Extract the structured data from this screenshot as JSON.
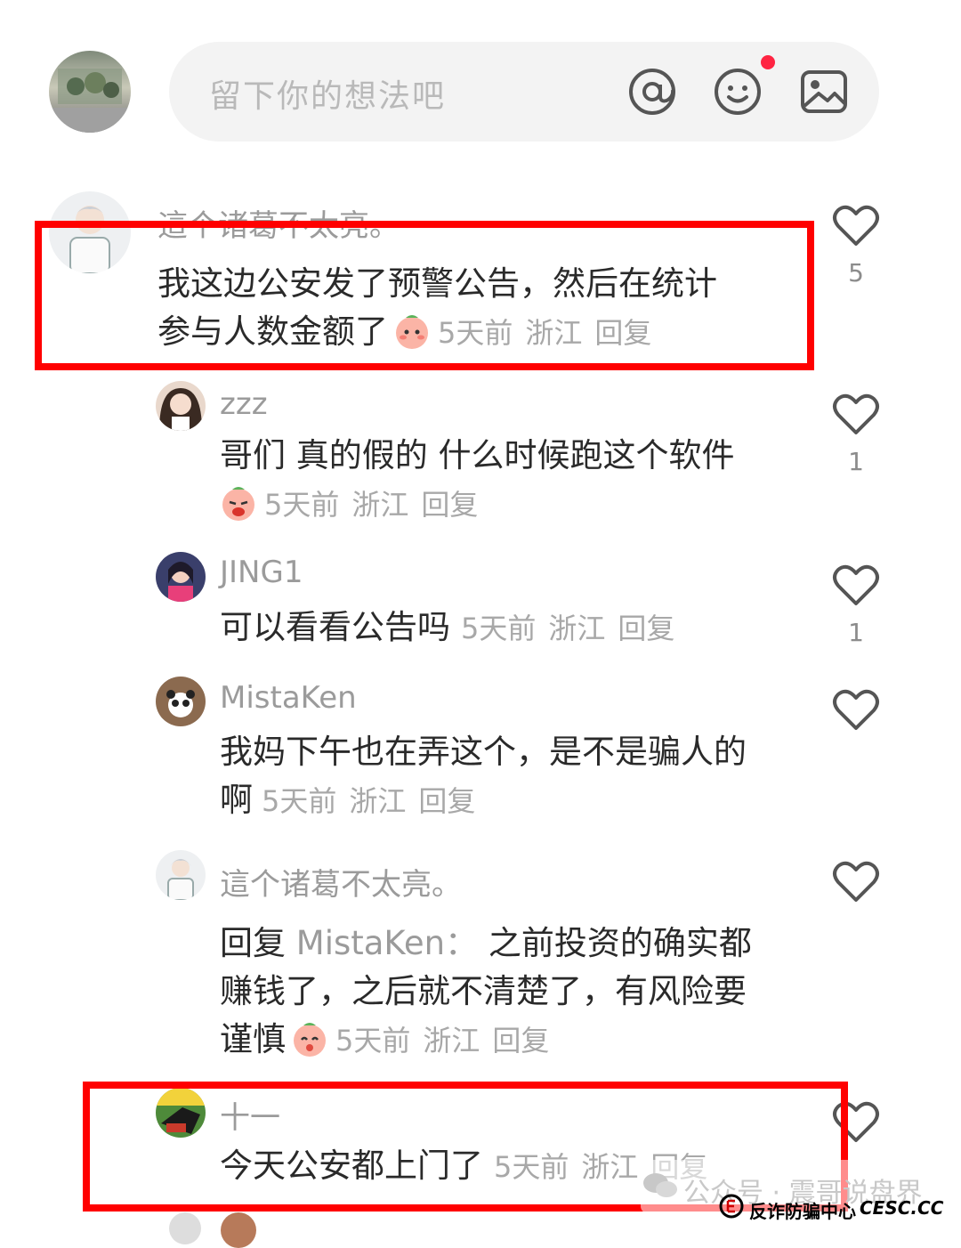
{
  "input": {
    "placeholder": "留下你的想法吧",
    "icons": [
      "at-icon",
      "emoji-icon",
      "image-icon"
    ]
  },
  "comments": [
    {
      "user": "這个诸葛不太亮。",
      "line1": "我这边公安发了预警公告，然后在统计",
      "line2": "参与人数金额了",
      "time": "5天前",
      "location": "浙江",
      "reply": "回复",
      "likes": "5"
    },
    {
      "user": "zzz",
      "line1": "哥们 真的假的 什么时候跑这个软件",
      "time": "5天前",
      "location": "浙江",
      "reply": "回复",
      "likes": "1"
    },
    {
      "user": "JING1",
      "line1": "可以看看公告吗",
      "time": "5天前",
      "location": "浙江",
      "reply": "回复",
      "likes": "1"
    },
    {
      "user": "MistaKen",
      "line1": "我妈下午也在弄这个，是不是骗人的",
      "line2": "啊",
      "time": "5天前",
      "location": "浙江",
      "reply": "回复",
      "likes": ""
    },
    {
      "user": "這个诸葛不太亮。",
      "reply_prefix": "回复",
      "reply_to": "MistaKen：",
      "line1": "之前投资的确实都",
      "line2": "赚钱了，之后就不清楚了，有风险要",
      "line3": "谨慎",
      "time": "5天前",
      "location": "浙江",
      "reply": "回复",
      "likes": ""
    },
    {
      "user": "十一",
      "line1": "今天公安都上门了",
      "time": "5天前",
      "location": "浙江",
      "reply": "回复",
      "likes": ""
    }
  ],
  "watermark": {
    "text": "公众号 · 震哥说盘界",
    "org": "反诈防骗中心",
    "site": "CESC.CC"
  },
  "colors": {
    "highlight": "#ff0000",
    "notification_dot": "#ff2442"
  }
}
